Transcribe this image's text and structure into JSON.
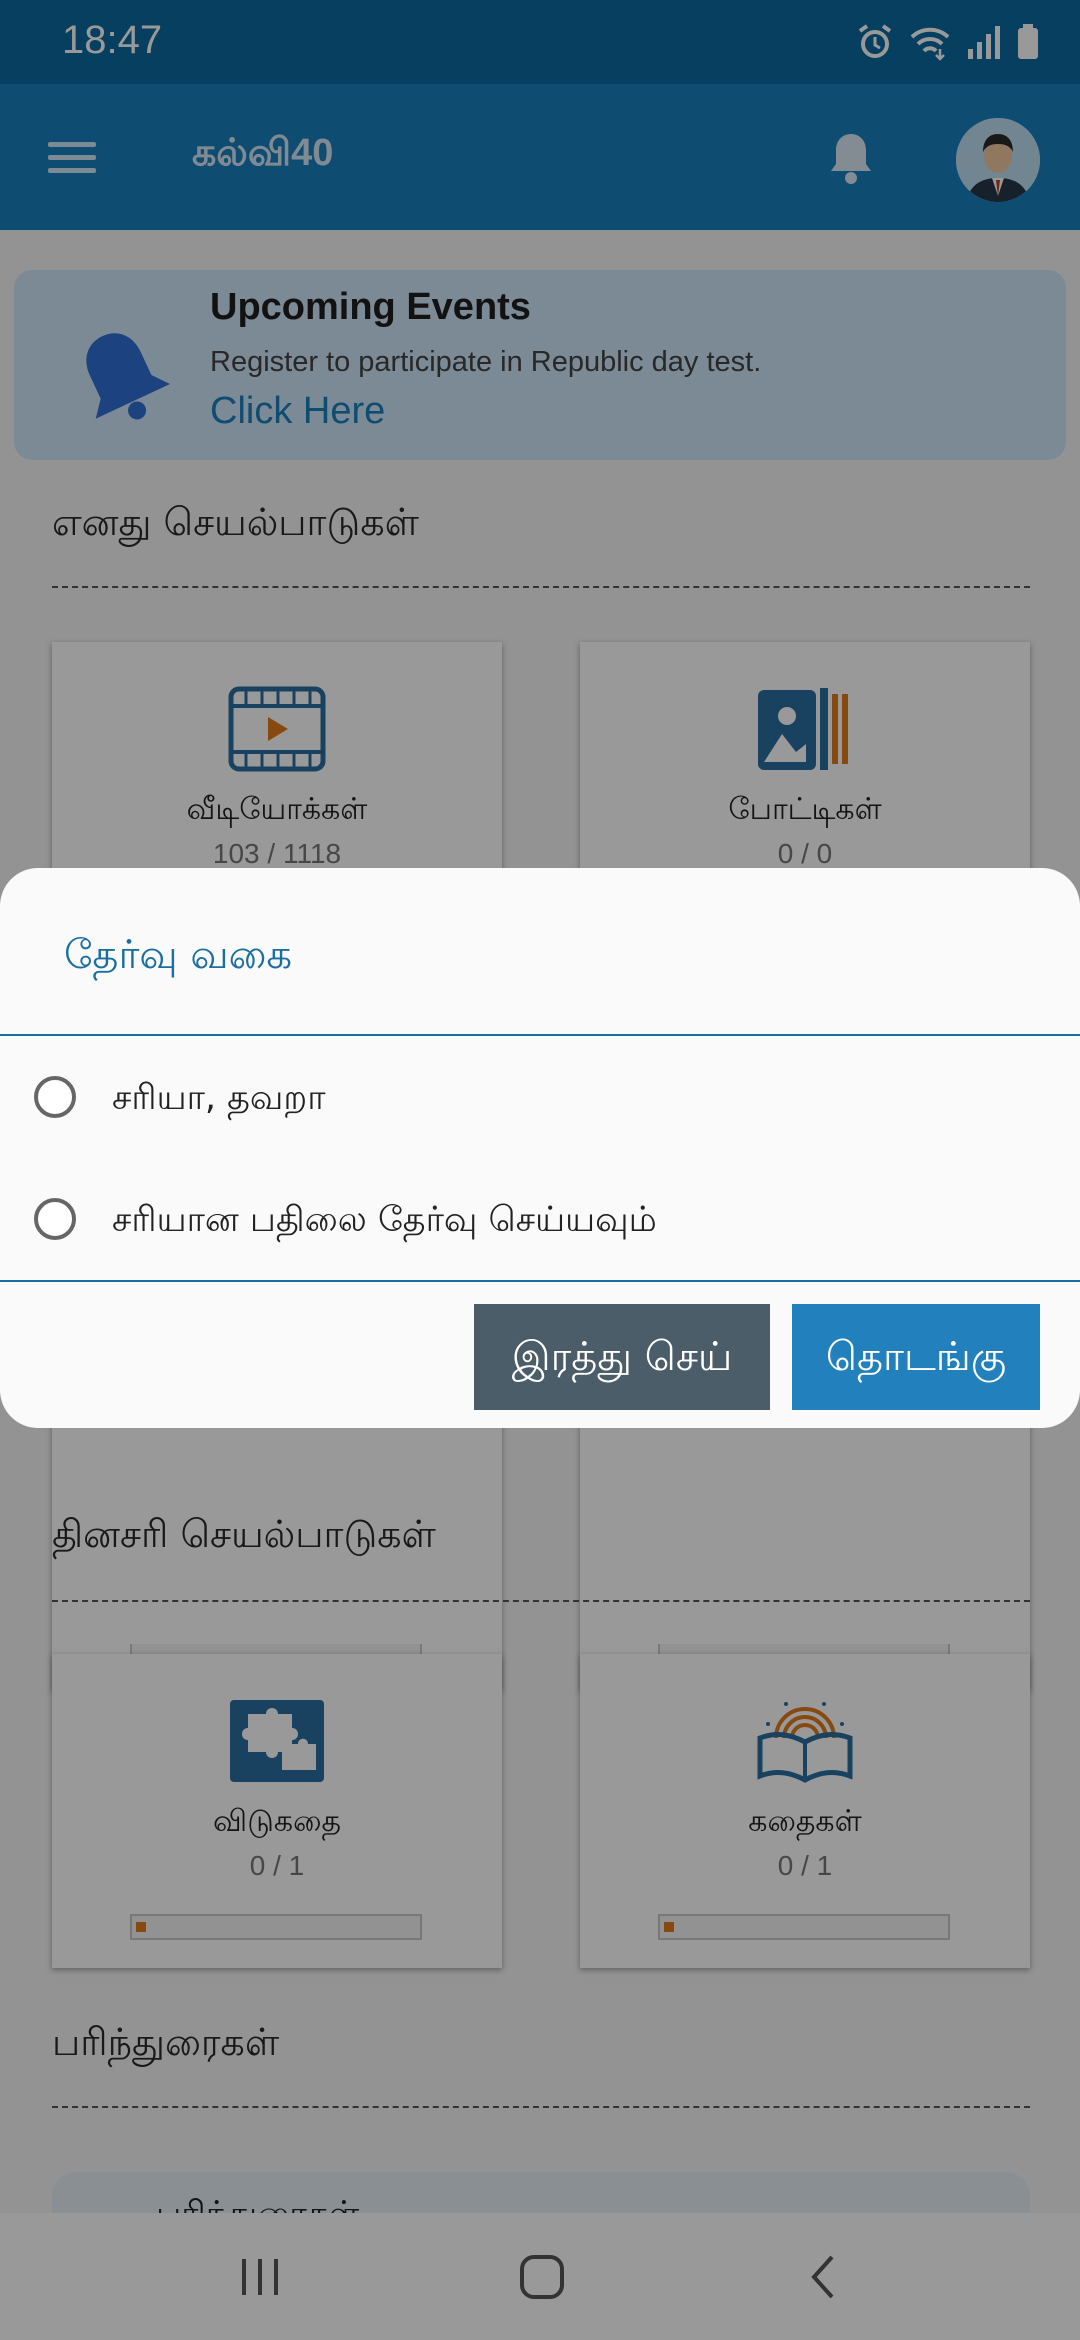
{
  "status_bar": {
    "time": "18:47",
    "icons": [
      "alarm-icon",
      "wifi-icon",
      "signal-icon",
      "battery-icon"
    ]
  },
  "app_bar": {
    "title": "கல்வி40",
    "icons": [
      "menu-icon",
      "notification-bell-icon",
      "avatar"
    ]
  },
  "event_banner": {
    "title": "Upcoming Events",
    "description": "Register to participate in Republic day test.",
    "link": "Click Here"
  },
  "sections": {
    "my_activities": "எனது செயல்பாடுகள்",
    "daily_activities": "தினசரி செயல்பாடுகள்",
    "recommendations": "பரிந்துரைகள்"
  },
  "tiles": [
    {
      "label": "வீடியோக்கள்",
      "count": "103 / 1118",
      "icon": "video-icon"
    },
    {
      "label": "போட்டிகள்",
      "count": "0 / 0",
      "icon": "competition-icon"
    },
    {
      "label": "விடுகதை",
      "count": "0 / 1",
      "icon": "puzzle-icon",
      "progress": 0.02
    },
    {
      "label": "கதைகள்",
      "count": "0 / 1",
      "icon": "story-book-icon",
      "progress": 0.02
    }
  ],
  "bottom_peek_label": "பரிந்துரைகள்",
  "dialog": {
    "title": "தேர்வு வகை",
    "options": [
      {
        "label": "சரியா, தவறா",
        "selected": false
      },
      {
        "label": "சரியான பதிலை தேர்வு செய்யவும்",
        "selected": false
      }
    ],
    "cancel_label": "இரத்து செய்",
    "start_label": "தொடங்கு"
  },
  "nav_bar": {
    "buttons": [
      "recent-apps-icon",
      "home-icon",
      "back-icon"
    ]
  },
  "colors": {
    "primary": "#1a7fbc",
    "status_bar": "#0b6a9e",
    "accent_orange": "#e07a1b",
    "cancel_button": "#4b5d68",
    "start_button": "#2280bd"
  }
}
